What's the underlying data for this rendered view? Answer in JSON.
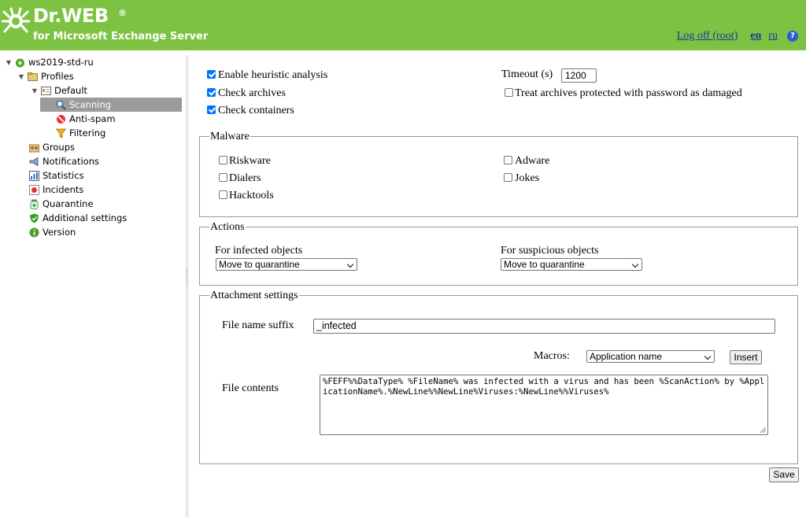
{
  "header": {
    "brand": "Dr.WEB",
    "subtitle": "for Microsoft Exchange Server",
    "logoff": "Log off (root)",
    "lang_en": "en",
    "lang_ru": "ru",
    "help": "?",
    "background_color": "#7dc242"
  },
  "sidebar": {
    "root": "ws2019-std-ru",
    "profiles": "Profiles",
    "default": "Default",
    "scanning": "Scanning",
    "antispam": "Anti-spam",
    "filtering": "Filtering",
    "groups": "Groups",
    "notifications": "Notifications",
    "statistics": "Statistics",
    "incidents": "Incidents",
    "quarantine": "Quarantine",
    "additional_settings": "Additional settings",
    "version": "Version",
    "selected_item": "Scanning"
  },
  "general": {
    "heuristic": {
      "label": "Enable heuristic analysis",
      "checked": true
    },
    "archives": {
      "label": "Check archives",
      "checked": true
    },
    "containers": {
      "label": "Check containers",
      "checked": true
    },
    "timeout_label": "Timeout (s)",
    "timeout_value": "1200",
    "protected_archives": {
      "label": "Treat archives protected with password as damaged",
      "checked": false
    }
  },
  "malware": {
    "legend": "Malware",
    "riskware": {
      "label": "Riskware",
      "checked": false
    },
    "dialers": {
      "label": "Dialers",
      "checked": false
    },
    "hacktools": {
      "label": "Hacktools",
      "checked": false
    },
    "adware": {
      "label": "Adware",
      "checked": false
    },
    "jokes": {
      "label": "Jokes",
      "checked": false
    }
  },
  "actions": {
    "legend": "Actions",
    "infected_label": "For infected objects",
    "infected_value": "Move to quarantine",
    "suspicious_label": "For suspicious objects",
    "suspicious_value": "Move to quarantine"
  },
  "attachment": {
    "legend": "Attachment settings",
    "suffix_label": "File name suffix",
    "suffix_value": "_infected",
    "macros_label": "Macros:",
    "macros_value": "Application name",
    "insert": "Insert",
    "contents_label": "File contents",
    "contents_value": "%FEFF%%DataType% %FileName% was infected with a virus and has been %ScanAction% by %ApplicationName%.%NewLine%%NewLine%Viruses:%NewLine%%Viruses%"
  },
  "save": "Save"
}
